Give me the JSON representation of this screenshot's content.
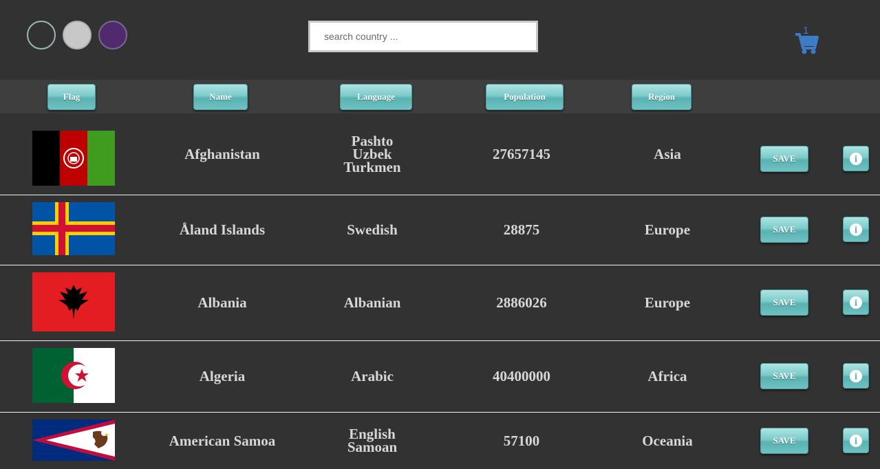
{
  "theme": {
    "dots": [
      {
        "name": "theme-dark-button",
        "color": "#323232",
        "border": "#9ab8b8"
      },
      {
        "name": "theme-light-button",
        "color": "#c8c8c8",
        "border": "#b0b0b0"
      },
      {
        "name": "theme-purple-button",
        "color": "#502a6e",
        "border": "#7a6a8e"
      }
    ]
  },
  "search": {
    "placeholder": "search country ...",
    "value": ""
  },
  "cart": {
    "count": "1",
    "icon": "cart-icon",
    "color": "#3c7cc6"
  },
  "columns": {
    "flag": "Flag",
    "name": "Name",
    "language": "Language",
    "population": "Population",
    "region": "Region"
  },
  "rows": [
    {
      "flag": "afghanistan-flag",
      "name": "Afghanistan",
      "languages": "Pashto\nUzbek\nTurkmen",
      "population": "27657145",
      "region": "Asia",
      "save": "SAVE",
      "info_icon": "info-icon"
    },
    {
      "flag": "aland-flag",
      "name": "Åland Islands",
      "languages": "Swedish",
      "population": "28875",
      "region": "Europe",
      "save": "SAVE",
      "info_icon": "info-icon"
    },
    {
      "flag": "albania-flag",
      "name": "Albania",
      "languages": "Albanian",
      "population": "2886026",
      "region": "Europe",
      "save": "SAVE",
      "info_icon": "info-icon"
    },
    {
      "flag": "algeria-flag",
      "name": "Algeria",
      "languages": "Arabic",
      "population": "40400000",
      "region": "Africa",
      "save": "SAVE",
      "info_icon": "info-icon"
    },
    {
      "flag": "american-samoa-flag",
      "name": "American Samoa",
      "languages": "English\nSamoan",
      "population": "57100",
      "region": "Oceania",
      "save": "SAVE",
      "info_icon": "info-icon"
    }
  ]
}
